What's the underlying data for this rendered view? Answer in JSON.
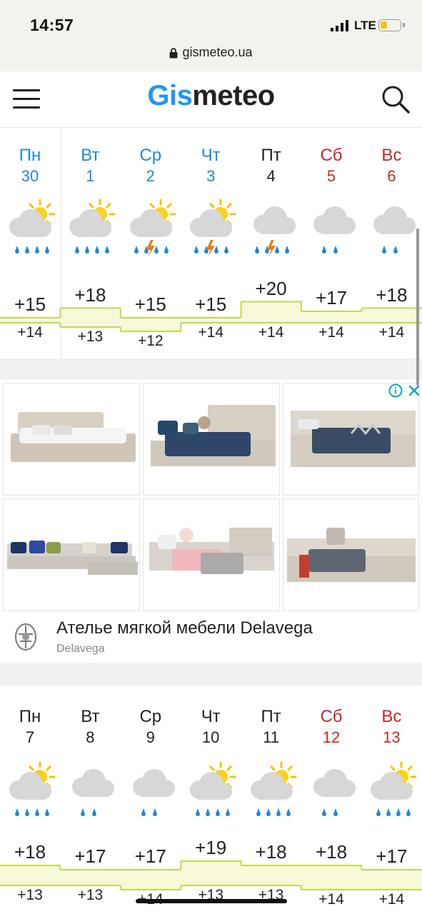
{
  "status": {
    "time": "14:57",
    "network": "LTE"
  },
  "browser": {
    "url": "gismeteo.ua"
  },
  "header": {
    "logo_part1": "Gis",
    "logo_part2": "meteo"
  },
  "week1": {
    "days": [
      {
        "name": "Пн",
        "num": "30",
        "color": "blue",
        "icon": "sun-cloud-rain",
        "max": "+15",
        "min": "+14"
      },
      {
        "name": "Вт",
        "num": "1",
        "color": "blue",
        "icon": "sun-cloud-rain",
        "max": "+18",
        "min": "+13"
      },
      {
        "name": "Ср",
        "num": "2",
        "color": "blue",
        "icon": "sun-cloud-thunder-rain",
        "max": "+15",
        "min": "+12"
      },
      {
        "name": "Чт",
        "num": "3",
        "color": "blue",
        "icon": "sun-cloud-thunder-rain",
        "max": "+15",
        "min": "+14"
      },
      {
        "name": "Пт",
        "num": "4",
        "color": "black",
        "icon": "cloud-thunder-rain",
        "max": "+20",
        "min": "+14"
      },
      {
        "name": "Сб",
        "num": "5",
        "color": "red",
        "icon": "cloud-rain",
        "max": "+17",
        "min": "+14"
      },
      {
        "name": "Вс",
        "num": "6",
        "color": "red",
        "icon": "cloud-rain",
        "max": "+18",
        "min": "+14"
      }
    ]
  },
  "ad": {
    "title": "Ателье мягкой мебели Delavega",
    "source": "Delavega",
    "info_icon": "info-icon",
    "close_icon": "close-icon"
  },
  "week2": {
    "days": [
      {
        "name": "Пн",
        "num": "7",
        "color": "black",
        "icon": "sun-cloud-rain",
        "max": "+18",
        "min": "+13"
      },
      {
        "name": "Вт",
        "num": "8",
        "color": "black",
        "icon": "cloud-rain",
        "max": "+17",
        "min": "+13"
      },
      {
        "name": "Ср",
        "num": "9",
        "color": "black",
        "icon": "cloud-rain",
        "max": "+17",
        "min": "+14"
      },
      {
        "name": "Чт",
        "num": "10",
        "color": "black",
        "icon": "sun-cloud-rain",
        "max": "+19",
        "min": "+13"
      },
      {
        "name": "Пт",
        "num": "11",
        "color": "black",
        "icon": "sun-cloud-rain",
        "max": "+18",
        "min": "+13"
      },
      {
        "name": "Сб",
        "num": "12",
        "color": "red",
        "icon": "cloud-rain",
        "max": "+18",
        "min": "+14"
      },
      {
        "name": "Вс",
        "num": "13",
        "color": "red",
        "icon": "sun-cloud-rain",
        "max": "+17",
        "min": "+14"
      }
    ]
  }
}
